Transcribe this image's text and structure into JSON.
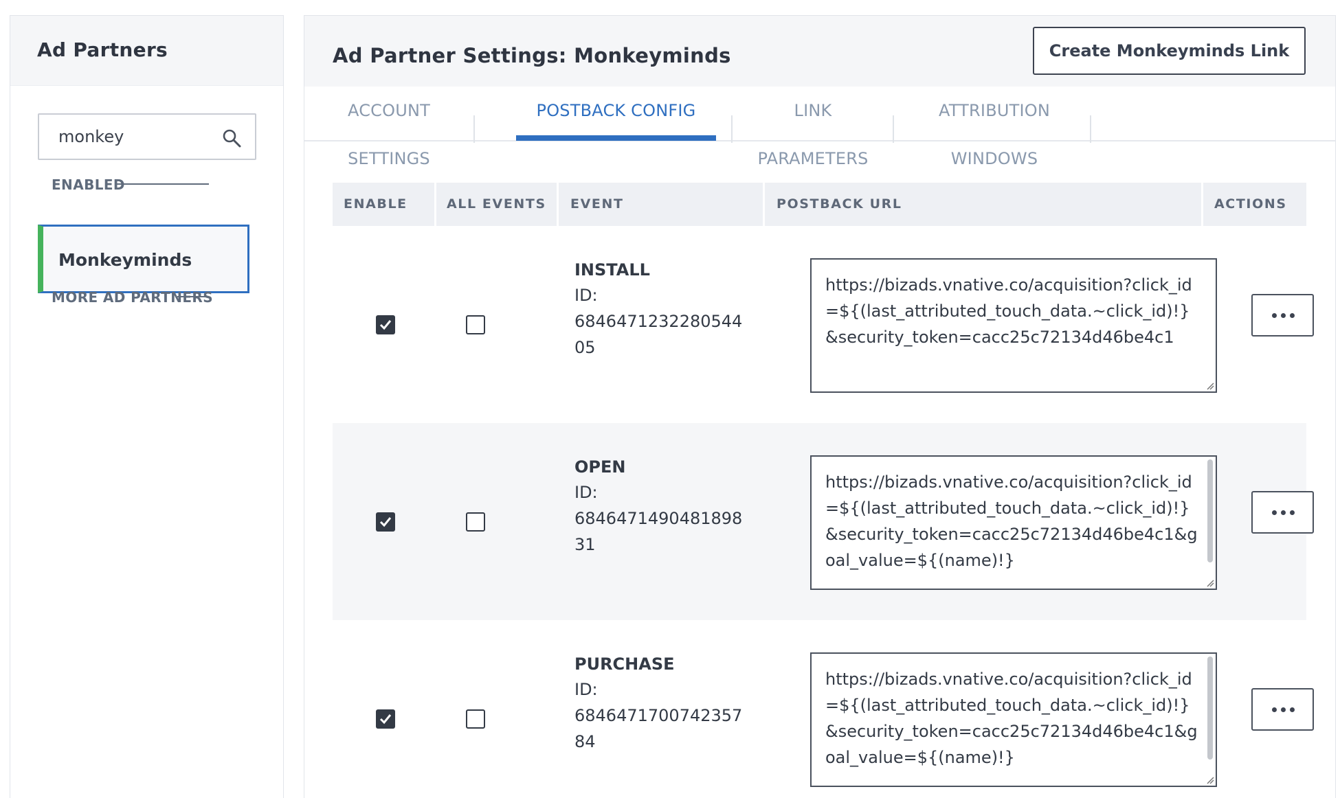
{
  "sidebar": {
    "title": "Ad Partners",
    "search": {
      "value": "monkey",
      "placeholder": ""
    },
    "enabled_label": "ENABLED",
    "more_label": "MORE AD PARTNERS",
    "items": [
      {
        "label": "Monkeyminds"
      }
    ]
  },
  "main": {
    "title": "Ad Partner Settings: Monkeyminds",
    "create_button": "Create Monkeyminds Link",
    "tabs": [
      {
        "label": "ACCOUNT SETTINGS"
      },
      {
        "label": "POSTBACK CONFIG"
      },
      {
        "label": "LINK PARAMETERS"
      },
      {
        "label": "ATTRIBUTION WINDOWS"
      }
    ],
    "active_tab": "POSTBACK CONFIG",
    "columns": [
      "ENABLE",
      "ALL EVENTS",
      "EVENT",
      "POSTBACK URL",
      "ACTIONS"
    ],
    "rows": [
      {
        "event": "INSTALL",
        "id_label": "ID:",
        "id": "684647123228054405",
        "enabled": true,
        "all_events": false,
        "url": "https://bizads.vnative.co/acquisition?click_id=${(last_attributed_touch_data.~click_id)!}&security_token=cacc25c72134d46be4c1"
      },
      {
        "event": "OPEN",
        "id_label": "ID:",
        "id": "684647149048189831",
        "enabled": true,
        "all_events": false,
        "url": "https://bizads.vnative.co/acquisition?click_id=${(last_attributed_touch_data.~click_id)!}&security_token=cacc25c72134d46be4c1&goal_value=${(name)!}"
      },
      {
        "event": "PURCHASE",
        "id_label": "ID:",
        "id": "684647170074235784",
        "enabled": true,
        "all_events": false,
        "url": "https://bizads.vnative.co/acquisition?click_id=${(last_attributed_touch_data.~click_id)!}&security_token=cacc25c72134d46be4c1&goal_value=${(name)!}"
      }
    ]
  },
  "colors": {
    "accent": "#2f6fc0",
    "enabled_marker": "#46b35c",
    "text": "#333a45",
    "muted": "#8a99ad",
    "header_bg": "#f5f6f8"
  },
  "icons": {
    "search": "search-icon",
    "checkbox_checked": "checkbox-checked-icon",
    "checkbox_unchecked": "checkbox-unchecked-icon",
    "more": "more-dots-icon"
  }
}
